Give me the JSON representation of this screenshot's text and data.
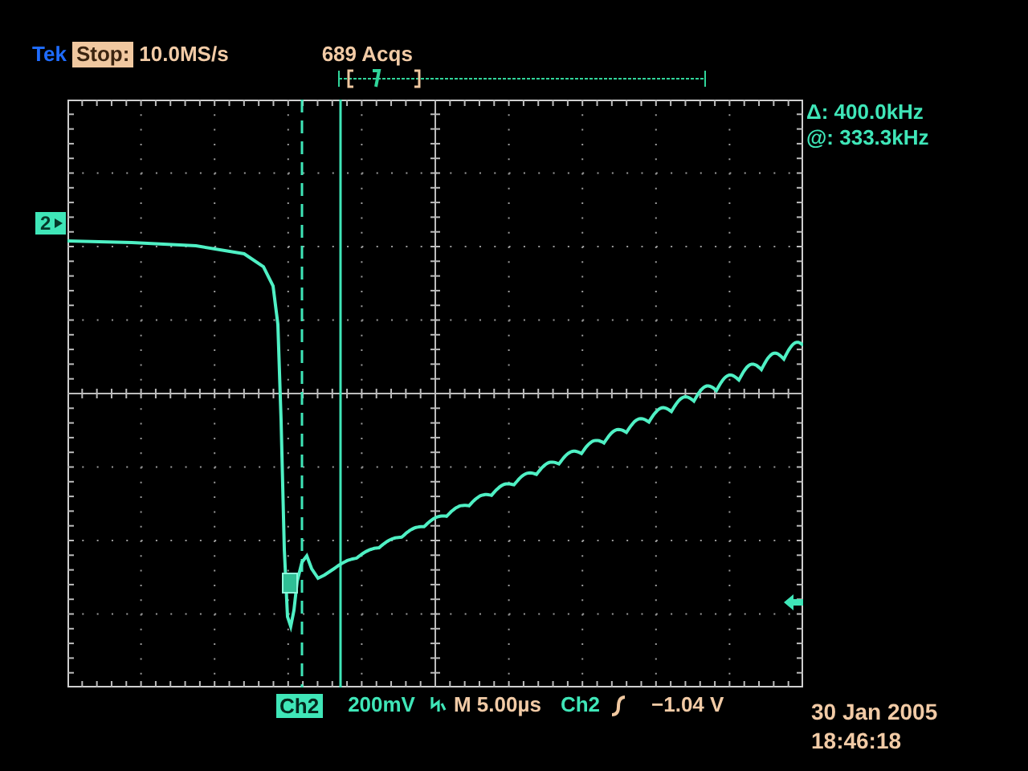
{
  "header": {
    "brand": "Tek",
    "run_state": "Stop:",
    "sample_rate": "10.0MS/s",
    "acquisitions": "689 Acqs"
  },
  "channel_marker": "2",
  "cursor_readout": {
    "delta": "Δ: 400.0kHz",
    "at": "@: 333.3kHz"
  },
  "footer": {
    "channel": "Ch2",
    "scale": "200mV",
    "timebase": "M 5.00µs",
    "trigger_source": "Ch2",
    "trigger_level": "−1.04 V"
  },
  "timestamp": {
    "date": "30 Jan 2005",
    "time": "18:46:18"
  }
}
